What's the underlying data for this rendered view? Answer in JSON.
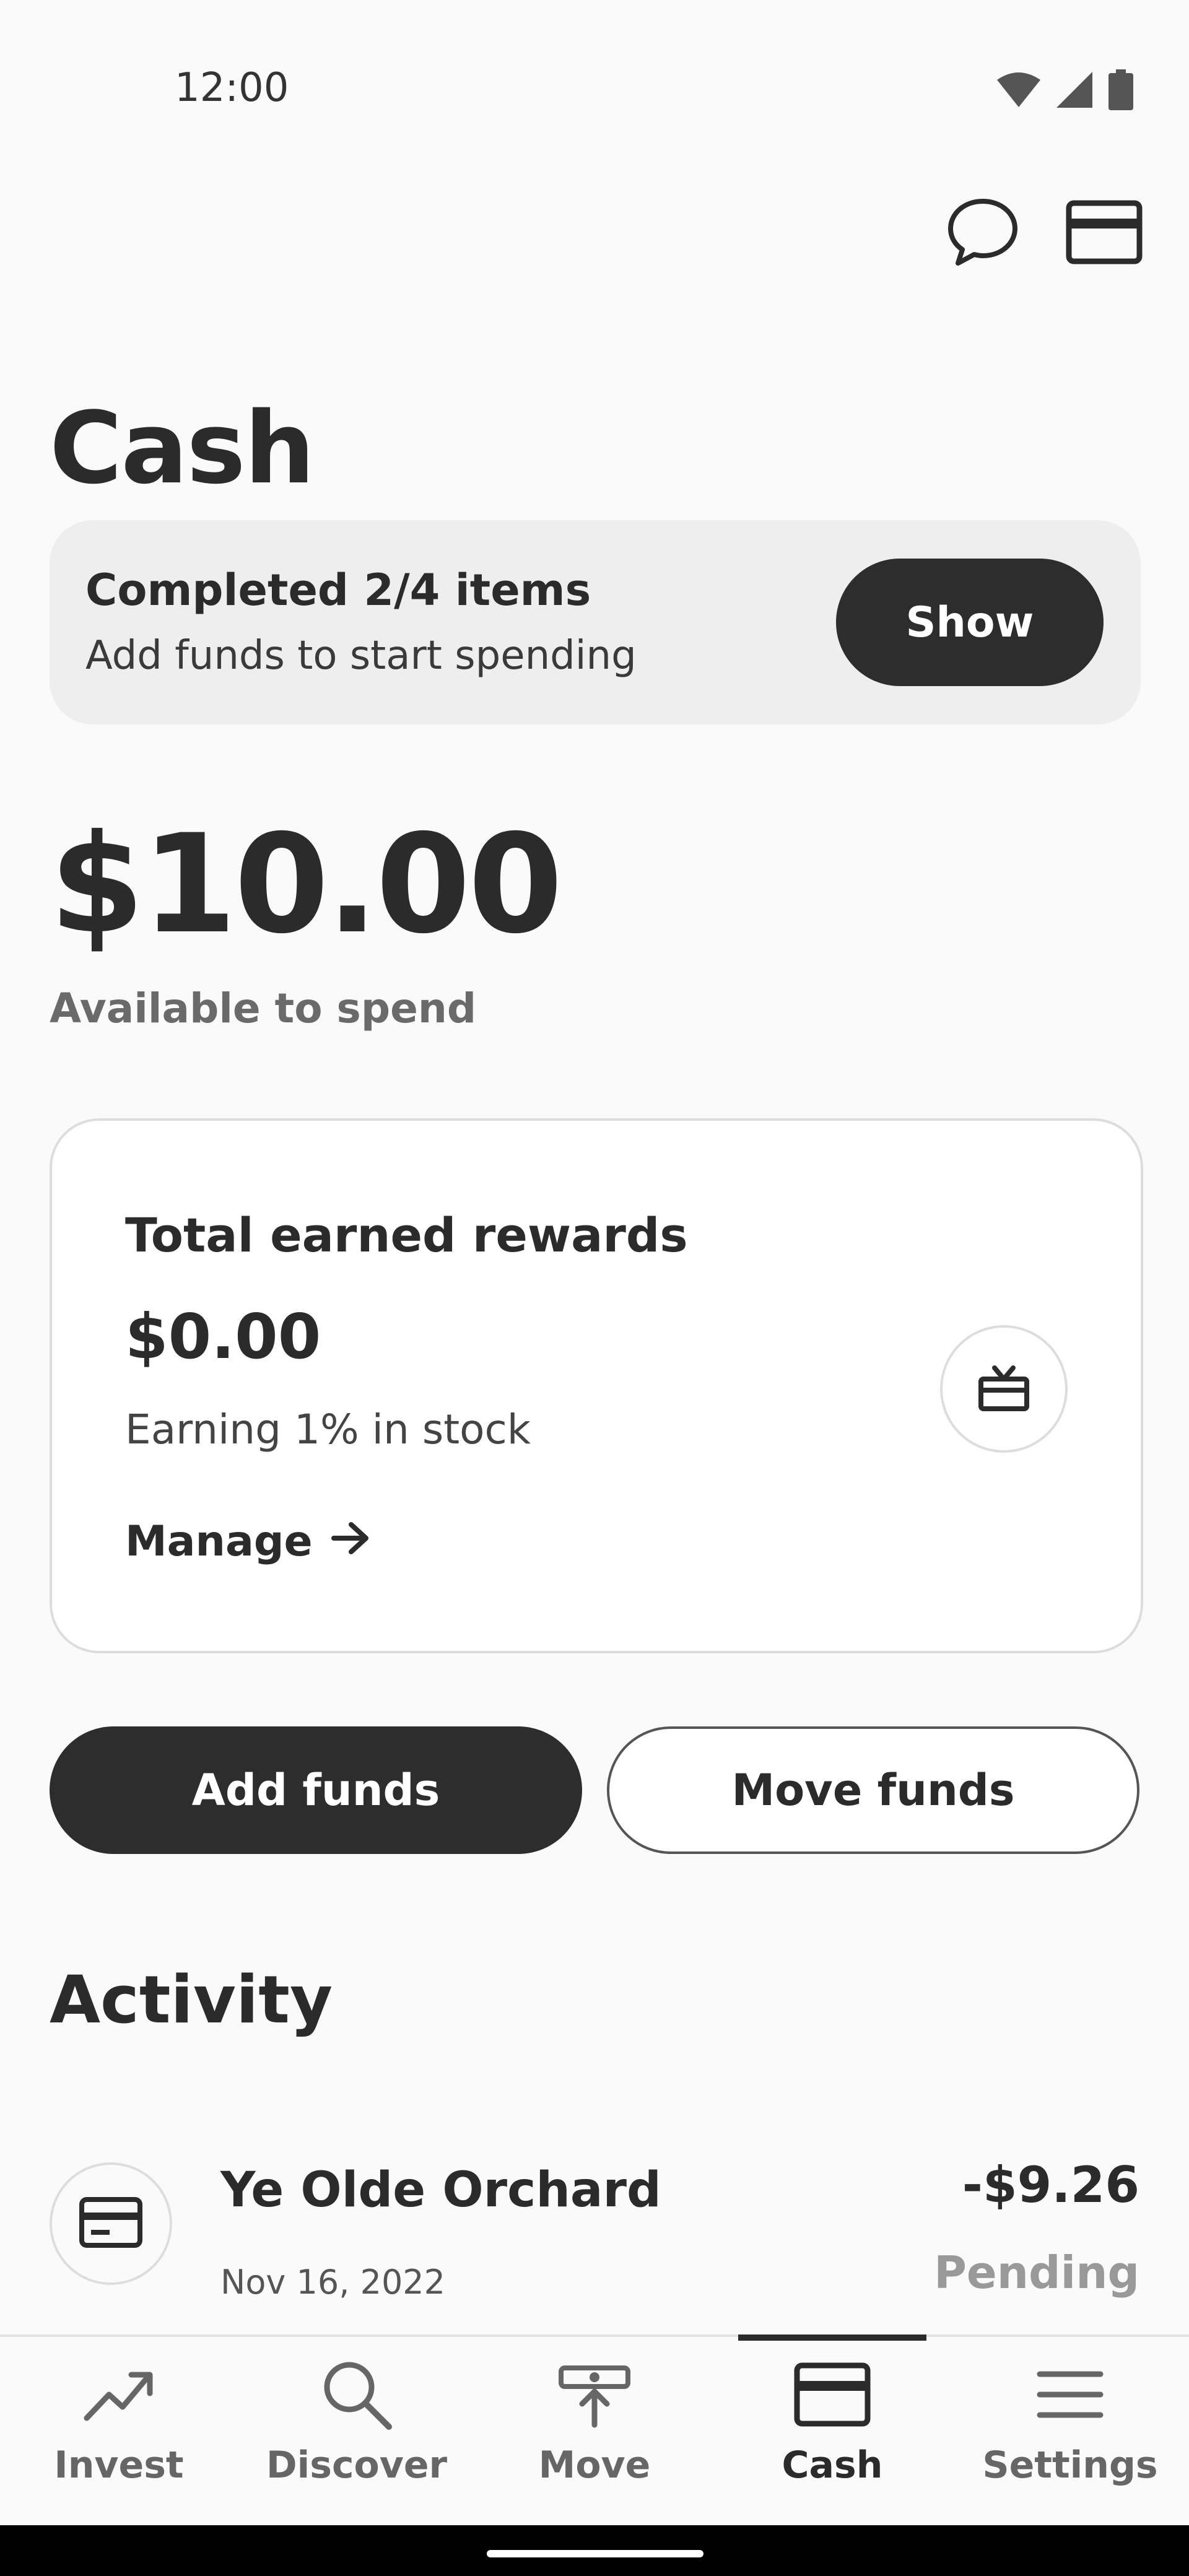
{
  "status_bar": {
    "time": "12:00",
    "icons": [
      "wifi-icon",
      "signal-icon",
      "battery-icon"
    ]
  },
  "header": {
    "icons": [
      "chat-bubble-icon",
      "card-icon"
    ]
  },
  "page": {
    "title": "Cash"
  },
  "checklist": {
    "title": "Completed 2/4 items",
    "subtitle": "Add funds to start spending",
    "button_label": "Show"
  },
  "balance": {
    "amount": "$10.00",
    "label": "Available to spend"
  },
  "rewards": {
    "title": "Total earned rewards",
    "amount": "$0.00",
    "note": "Earning 1% in stock",
    "manage_label": "Manage",
    "icon": "gift-icon"
  },
  "actions": {
    "add_funds_label": "Add funds",
    "move_funds_label": "Move funds"
  },
  "activity": {
    "title": "Activity",
    "transactions": [
      {
        "name": "Ye Olde Orchard",
        "date": "Nov 16, 2022",
        "amount": "-$9.26",
        "status": "Pending",
        "icon": "card-icon"
      }
    ]
  },
  "bottom_nav": {
    "items": [
      {
        "label": "Invest",
        "icon": "trend-up-icon",
        "active": false
      },
      {
        "label": "Discover",
        "icon": "search-icon",
        "active": false
      },
      {
        "label": "Move",
        "icon": "move-money-icon",
        "active": false
      },
      {
        "label": "Cash",
        "icon": "card-icon",
        "active": true
      },
      {
        "label": "Settings",
        "icon": "menu-icon",
        "active": false
      }
    ]
  },
  "colors": {
    "background": "#fafafa",
    "primary_dark": "#2d2d2d",
    "card_muted": "#eeeeee",
    "border": "#dddddd",
    "text_muted": "#6a6a6a",
    "pending": "#999999"
  }
}
